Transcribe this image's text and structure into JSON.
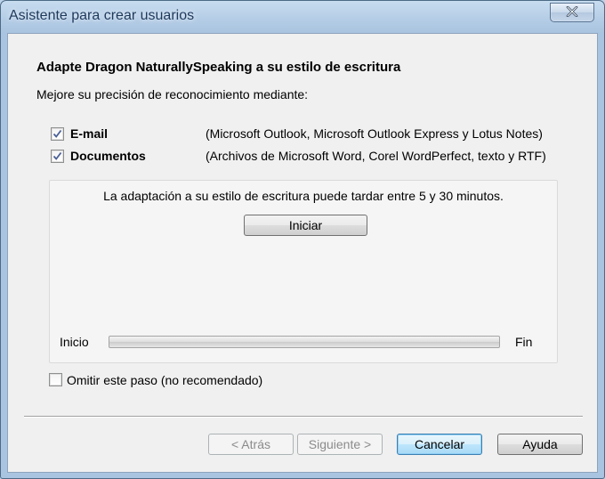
{
  "window": {
    "title": "Asistente para crear usuarios"
  },
  "content": {
    "heading": "Adapte Dragon NaturallySpeaking a su estilo de escritura",
    "subtext": "Mejore su precisión de reconocimiento mediante:",
    "options": [
      {
        "label": "E-mail",
        "description": "(Microsoft Outlook, Microsoft Outlook Express y Lotus Notes)",
        "checked": true
      },
      {
        "label": "Documentos",
        "description": "(Archivos de Microsoft Word, Corel WordPerfect, texto y RTF)",
        "checked": true
      }
    ],
    "panel": {
      "info": "La adaptación a su estilo de escritura puede tardar entre 5 y 30 minutos.",
      "start_button": "Iniciar",
      "progress_start_label": "Inicio",
      "progress_end_label": "Fin",
      "progress": 0
    },
    "skip": {
      "label": "Omitir este paso (no recomendado)",
      "checked": false
    }
  },
  "footer": {
    "back_button": "< Atrás",
    "next_button": "Siguiente >",
    "cancel_button": "Cancelar",
    "help_button": "Ayuda"
  }
}
